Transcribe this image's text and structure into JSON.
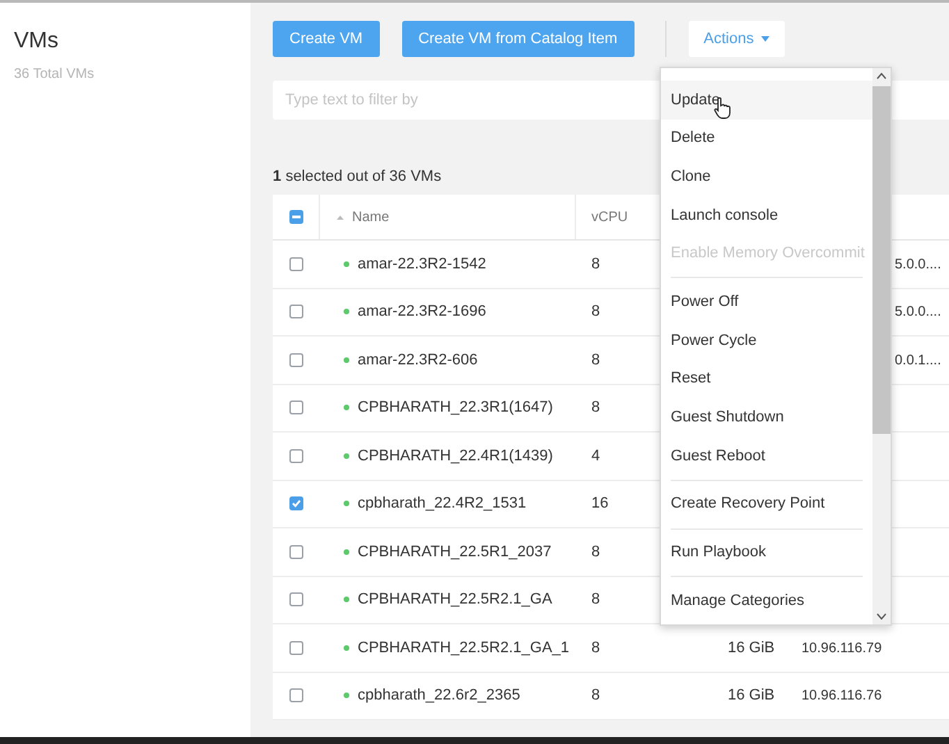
{
  "sidebar": {
    "title": "VMs",
    "subtitle": "36 Total VMs"
  },
  "toolbar": {
    "buttons": [
      "Create VM",
      "Create VM from Catalog Item"
    ],
    "actions": {
      "label": "Actions"
    }
  },
  "filter": {
    "placeholder": "Type text to filter by"
  },
  "selection_summary": {
    "count": "1",
    "text": "selected out of 36 VMs"
  },
  "table": {
    "all_checkbox": {
      "partial": true
    },
    "columns": [
      "Name",
      "vCPU"
    ],
    "rows": [
      {
        "name": "amar-22.3R2-1542",
        "vcpu": "8",
        "ip": "5.0.0....",
        "checked": false,
        "color": "#5cc96b"
      },
      {
        "name": "amar-22.3R2-1696",
        "vcpu": "8",
        "ip": "5.0.0....",
        "checked": false,
        "color": "#5cc96b"
      },
      {
        "name": "amar-22.3R2-606",
        "vcpu": "8",
        "ip": "0.0.1....",
        "checked": false,
        "color": "#5cc96b"
      },
      {
        "name": "CPBHARATH_22.3R1(1647)",
        "vcpu": "8",
        "checked": false,
        "color": "#5cc96b"
      },
      {
        "name": "CPBHARATH_22.4R1(1439)",
        "vcpu": "4",
        "checked": false,
        "color": "#5cc96b"
      },
      {
        "name": "cpbharath_22.4R2_1531",
        "vcpu": "16",
        "checked": true,
        "color": "#5cc96b"
      },
      {
        "name": "CPBHARATH_22.5R1_2037",
        "vcpu": "8",
        "checked": false,
        "color": "#5cc96b"
      },
      {
        "name": "CPBHARATH_22.5R2.1_GA",
        "vcpu": "8",
        "checked": false,
        "color": "#5cc96b"
      },
      {
        "name": "CPBHARATH_22.5R2.1_GA_1",
        "vcpu": "8",
        "memory": "16 GiB",
        "ip": "10.96.116.79",
        "checked": false,
        "color": "#5cc96b"
      },
      {
        "name": "cpbharath_22.6r2_2365",
        "vcpu": "8",
        "memory": "16 GiB",
        "ip": "10.96.116.76",
        "checked": false,
        "color": "#5cc96b"
      }
    ]
  },
  "actions_menu": {
    "items": [
      {
        "label": "Update",
        "hovered": true,
        "disabled": false,
        "divider_after": false
      },
      {
        "label": "Delete",
        "hovered": false,
        "disabled": false,
        "divider_after": false
      },
      {
        "label": "Clone",
        "hovered": false,
        "disabled": false,
        "divider_after": false
      },
      {
        "label": "Launch console",
        "hovered": false,
        "disabled": false,
        "divider_after": false
      },
      {
        "label": "Enable Memory Overcommit",
        "hovered": false,
        "disabled": true,
        "divider_after": true
      },
      {
        "label": "Power Off",
        "hovered": false,
        "disabled": false,
        "divider_after": false
      },
      {
        "label": "Power Cycle",
        "hovered": false,
        "disabled": false,
        "divider_after": false
      },
      {
        "label": "Reset",
        "hovered": false,
        "disabled": false,
        "divider_after": false
      },
      {
        "label": "Guest Shutdown",
        "hovered": false,
        "disabled": false,
        "divider_after": false
      },
      {
        "label": "Guest Reboot",
        "hovered": false,
        "disabled": false,
        "divider_after": true
      },
      {
        "label": "Create Recovery Point",
        "hovered": false,
        "disabled": false,
        "divider_after": true
      },
      {
        "label": "Run Playbook",
        "hovered": false,
        "disabled": false,
        "divider_after": true
      },
      {
        "label": "Manage Categories",
        "hovered": false,
        "disabled": false,
        "divider_after": false
      }
    ]
  }
}
